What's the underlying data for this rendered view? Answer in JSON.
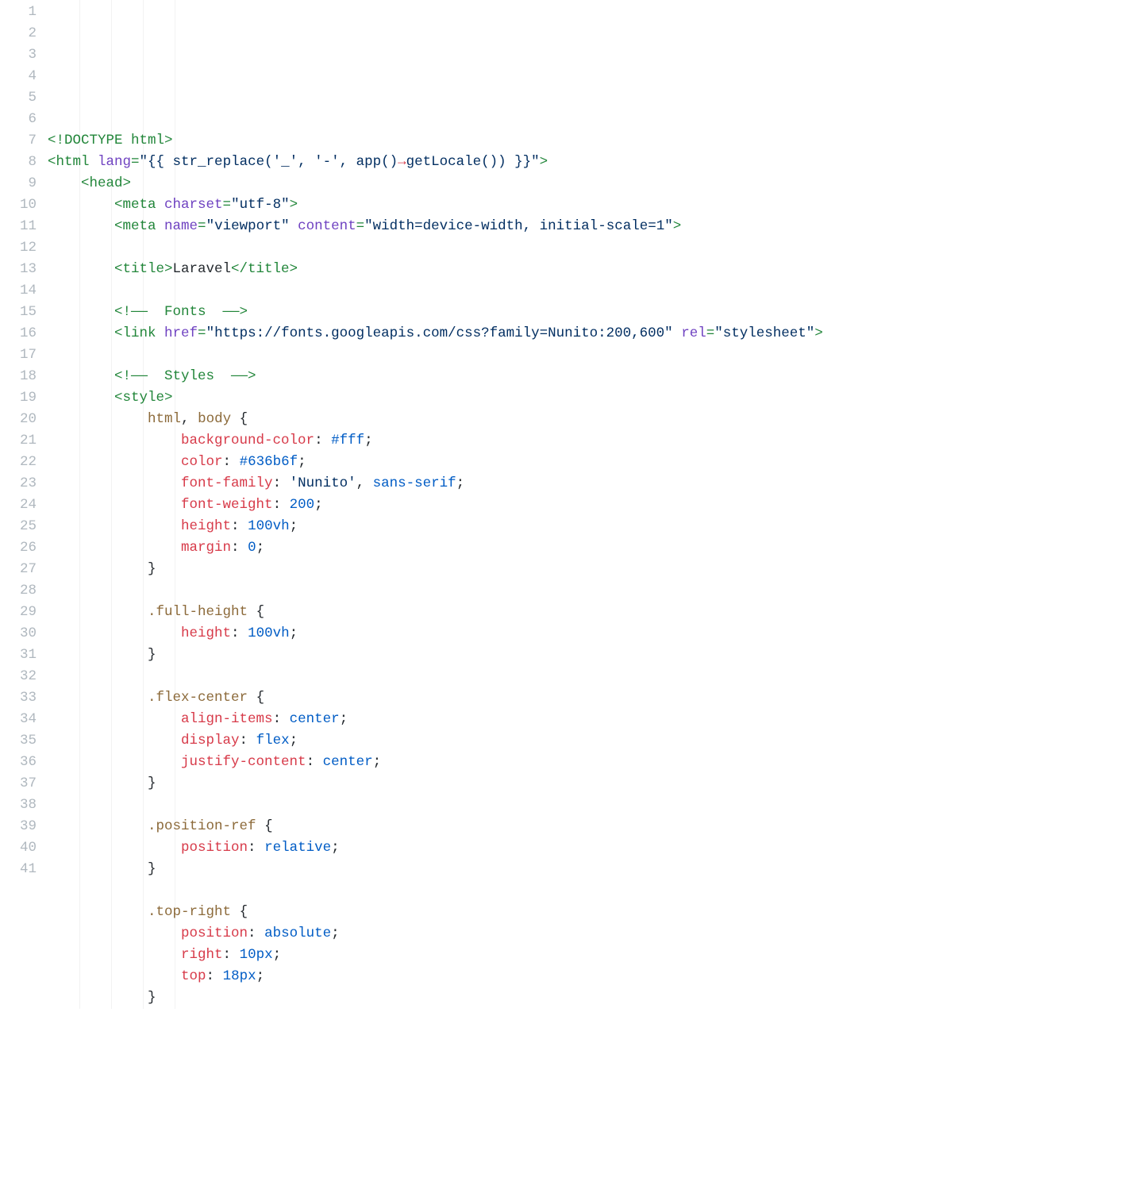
{
  "lines": [
    {
      "n": 1,
      "indent": 0,
      "tokens": [
        [
          "tag",
          "<!DOCTYPE html>"
        ]
      ]
    },
    {
      "n": 2,
      "indent": 0,
      "tokens": [
        [
          "tag",
          "<html "
        ],
        [
          "attr",
          "lang"
        ],
        [
          "tag",
          "="
        ],
        [
          "str",
          "\"{{ str_replace('_', '-', app()"
        ],
        [
          "op",
          "→"
        ],
        [
          "str",
          "getLocale()) }}\""
        ],
        [
          "tag",
          ">"
        ]
      ]
    },
    {
      "n": 3,
      "indent": 1,
      "tokens": [
        [
          "tag",
          "<head>"
        ]
      ]
    },
    {
      "n": 4,
      "indent": 2,
      "tokens": [
        [
          "tag",
          "<meta "
        ],
        [
          "attr",
          "charset"
        ],
        [
          "tag",
          "="
        ],
        [
          "str",
          "\"utf-8\""
        ],
        [
          "tag",
          ">"
        ]
      ]
    },
    {
      "n": 5,
      "indent": 2,
      "tokens": [
        [
          "tag",
          "<meta "
        ],
        [
          "attr",
          "name"
        ],
        [
          "tag",
          "="
        ],
        [
          "str",
          "\"viewport\""
        ],
        [
          "tag",
          " "
        ],
        [
          "attr",
          "content"
        ],
        [
          "tag",
          "="
        ],
        [
          "str",
          "\"width=device-width, initial-scale=1\""
        ],
        [
          "tag",
          ">"
        ]
      ]
    },
    {
      "n": 6,
      "indent": 0,
      "tokens": []
    },
    {
      "n": 7,
      "indent": 2,
      "tokens": [
        [
          "tag",
          "<title>"
        ],
        [
          "txt",
          "Laravel"
        ],
        [
          "tag",
          "</title>"
        ]
      ]
    },
    {
      "n": 8,
      "indent": 0,
      "tokens": []
    },
    {
      "n": 9,
      "indent": 2,
      "tokens": [
        [
          "cmt",
          "<!——  Fonts  ——>"
        ]
      ]
    },
    {
      "n": 10,
      "indent": 2,
      "tokens": [
        [
          "tag",
          "<link "
        ],
        [
          "attr",
          "href"
        ],
        [
          "tag",
          "="
        ],
        [
          "str",
          "\"https://fonts.googleapis.com/css?family=Nunito:200,600\""
        ],
        [
          "tag",
          " "
        ],
        [
          "attr",
          "rel"
        ],
        [
          "tag",
          "="
        ],
        [
          "str",
          "\"stylesheet\""
        ],
        [
          "tag",
          ">"
        ]
      ]
    },
    {
      "n": 11,
      "indent": 0,
      "tokens": []
    },
    {
      "n": 12,
      "indent": 2,
      "tokens": [
        [
          "cmt",
          "<!——  Styles  ——>"
        ]
      ]
    },
    {
      "n": 13,
      "indent": 2,
      "tokens": [
        [
          "tag",
          "<style>"
        ]
      ]
    },
    {
      "n": 14,
      "indent": 3,
      "tokens": [
        [
          "csssel",
          "html"
        ],
        [
          "txt",
          ", "
        ],
        [
          "csssel",
          "body"
        ],
        [
          "txt",
          " {"
        ]
      ]
    },
    {
      "n": 15,
      "indent": 4,
      "tokens": [
        [
          "prop",
          "background-color"
        ],
        [
          "txt",
          ": "
        ],
        [
          "val",
          "#fff"
        ],
        [
          "txt",
          ";"
        ]
      ]
    },
    {
      "n": 16,
      "indent": 4,
      "tokens": [
        [
          "prop",
          "color"
        ],
        [
          "txt",
          ": "
        ],
        [
          "val",
          "#636b6f"
        ],
        [
          "txt",
          ";"
        ]
      ]
    },
    {
      "n": 17,
      "indent": 4,
      "tokens": [
        [
          "prop",
          "font-family"
        ],
        [
          "txt",
          ": "
        ],
        [
          "str",
          "'Nunito'"
        ],
        [
          "txt",
          ", "
        ],
        [
          "val",
          "sans-serif"
        ],
        [
          "txt",
          ";"
        ]
      ]
    },
    {
      "n": 18,
      "indent": 4,
      "tokens": [
        [
          "prop",
          "font-weight"
        ],
        [
          "txt",
          ": "
        ],
        [
          "num",
          "200"
        ],
        [
          "txt",
          ";"
        ]
      ]
    },
    {
      "n": 19,
      "indent": 4,
      "tokens": [
        [
          "prop",
          "height"
        ],
        [
          "txt",
          ": "
        ],
        [
          "num",
          "100vh"
        ],
        [
          "txt",
          ";"
        ]
      ]
    },
    {
      "n": 20,
      "indent": 4,
      "tokens": [
        [
          "prop",
          "margin"
        ],
        [
          "txt",
          ": "
        ],
        [
          "num",
          "0"
        ],
        [
          "txt",
          ";"
        ]
      ]
    },
    {
      "n": 21,
      "indent": 3,
      "tokens": [
        [
          "txt",
          "}"
        ]
      ]
    },
    {
      "n": 22,
      "indent": 0,
      "tokens": []
    },
    {
      "n": 23,
      "indent": 3,
      "tokens": [
        [
          "csssel",
          ".full-height"
        ],
        [
          "txt",
          " {"
        ]
      ]
    },
    {
      "n": 24,
      "indent": 4,
      "tokens": [
        [
          "prop",
          "height"
        ],
        [
          "txt",
          ": "
        ],
        [
          "num",
          "100vh"
        ],
        [
          "txt",
          ";"
        ]
      ]
    },
    {
      "n": 25,
      "indent": 3,
      "tokens": [
        [
          "txt",
          "}"
        ]
      ]
    },
    {
      "n": 26,
      "indent": 0,
      "tokens": []
    },
    {
      "n": 27,
      "indent": 3,
      "tokens": [
        [
          "csssel",
          ".flex-center"
        ],
        [
          "txt",
          " {"
        ]
      ]
    },
    {
      "n": 28,
      "indent": 4,
      "tokens": [
        [
          "prop",
          "align-items"
        ],
        [
          "txt",
          ": "
        ],
        [
          "val",
          "center"
        ],
        [
          "txt",
          ";"
        ]
      ]
    },
    {
      "n": 29,
      "indent": 4,
      "tokens": [
        [
          "prop",
          "display"
        ],
        [
          "txt",
          ": "
        ],
        [
          "val",
          "flex"
        ],
        [
          "txt",
          ";"
        ]
      ]
    },
    {
      "n": 30,
      "indent": 4,
      "tokens": [
        [
          "prop",
          "justify-content"
        ],
        [
          "txt",
          ": "
        ],
        [
          "val",
          "center"
        ],
        [
          "txt",
          ";"
        ]
      ]
    },
    {
      "n": 31,
      "indent": 3,
      "tokens": [
        [
          "txt",
          "}"
        ]
      ]
    },
    {
      "n": 32,
      "indent": 0,
      "tokens": []
    },
    {
      "n": 33,
      "indent": 3,
      "tokens": [
        [
          "csssel",
          ".position-ref"
        ],
        [
          "txt",
          " {"
        ]
      ]
    },
    {
      "n": 34,
      "indent": 4,
      "tokens": [
        [
          "prop",
          "position"
        ],
        [
          "txt",
          ": "
        ],
        [
          "val",
          "relative"
        ],
        [
          "txt",
          ";"
        ]
      ]
    },
    {
      "n": 35,
      "indent": 3,
      "tokens": [
        [
          "txt",
          "}"
        ]
      ]
    },
    {
      "n": 36,
      "indent": 0,
      "tokens": []
    },
    {
      "n": 37,
      "indent": 3,
      "tokens": [
        [
          "csssel",
          ".top-right"
        ],
        [
          "txt",
          " {"
        ]
      ]
    },
    {
      "n": 38,
      "indent": 4,
      "tokens": [
        [
          "prop",
          "position"
        ],
        [
          "txt",
          ": "
        ],
        [
          "val",
          "absolute"
        ],
        [
          "txt",
          ";"
        ]
      ]
    },
    {
      "n": 39,
      "indent": 4,
      "tokens": [
        [
          "prop",
          "right"
        ],
        [
          "txt",
          ": "
        ],
        [
          "num",
          "10px"
        ],
        [
          "txt",
          ";"
        ]
      ]
    },
    {
      "n": 40,
      "indent": 4,
      "tokens": [
        [
          "prop",
          "top"
        ],
        [
          "txt",
          ": "
        ],
        [
          "num",
          "18px"
        ],
        [
          "txt",
          ";"
        ]
      ]
    },
    {
      "n": 41,
      "indent": 3,
      "tokens": [
        [
          "txt",
          "}"
        ]
      ]
    }
  ]
}
